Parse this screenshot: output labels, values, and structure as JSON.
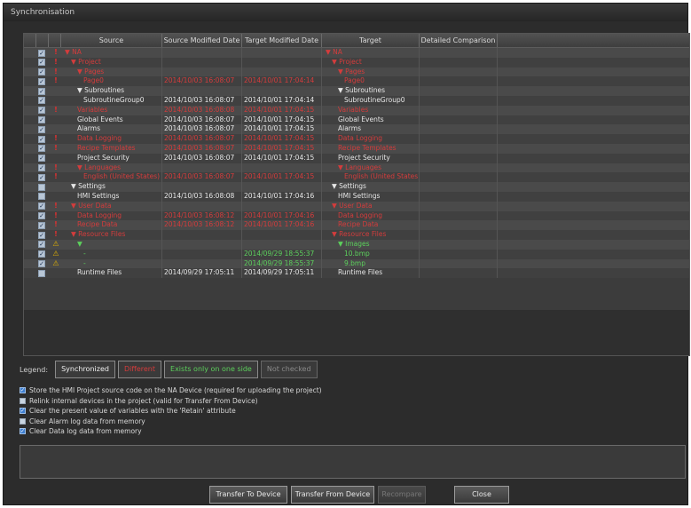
{
  "window": {
    "title": "Synchronisation"
  },
  "grid": {
    "headers": [
      "Source",
      "Source Modified Date",
      "Target Modified Date",
      "Target",
      "Detailed Comparison"
    ],
    "rows": [
      {
        "chk": true,
        "flag": "!",
        "src": "▼ NA",
        "sd": "",
        "td": "",
        "tgt": "▼ NA",
        "cls": "diff",
        "indent": 0
      },
      {
        "chk": true,
        "flag": "!",
        "src": "▼ Project",
        "sd": "",
        "td": "",
        "tgt": "▼ Project",
        "cls": "diff",
        "indent": 1
      },
      {
        "chk": true,
        "flag": "!",
        "src": "▼ Pages",
        "sd": "",
        "td": "",
        "tgt": "▼ Pages",
        "cls": "diff",
        "indent": 2
      },
      {
        "chk": true,
        "flag": "!",
        "src": "Page0",
        "sd": "2014/10/03 16:08:07",
        "td": "2014/10/01 17:04:14",
        "tgt": "Page0",
        "cls": "diff",
        "indent": 3
      },
      {
        "chk": true,
        "flag": "",
        "src": "▼ Subroutines",
        "sd": "",
        "td": "",
        "tgt": "▼ Subroutines",
        "cls": "",
        "indent": 2
      },
      {
        "chk": true,
        "flag": "",
        "src": "SubroutineGroup0",
        "sd": "2014/10/03 16:08:07",
        "td": "2014/10/01 17:04:14",
        "tgt": "SubroutineGroup0",
        "cls": "",
        "indent": 3
      },
      {
        "chk": true,
        "flag": "!",
        "src": "Variables",
        "sd": "2014/10/03 16:08:08",
        "td": "2014/10/01 17:04:15",
        "tgt": "Variables",
        "cls": "diff",
        "indent": 2
      },
      {
        "chk": true,
        "flag": "",
        "src": "Global Events",
        "sd": "2014/10/03 16:08:07",
        "td": "2014/10/01 17:04:15",
        "tgt": "Global Events",
        "cls": "",
        "indent": 2
      },
      {
        "chk": true,
        "flag": "",
        "src": "Alarms",
        "sd": "2014/10/03 16:08:07",
        "td": "2014/10/01 17:04:15",
        "tgt": "Alarms",
        "cls": "",
        "indent": 2
      },
      {
        "chk": true,
        "flag": "!",
        "src": "Data Logging",
        "sd": "2014/10/03 16:08:07",
        "td": "2014/10/01 17:04:15",
        "tgt": "Data Logging",
        "cls": "diff",
        "indent": 2
      },
      {
        "chk": true,
        "flag": "!",
        "src": "Recipe Templates",
        "sd": "2014/10/03 16:08:07",
        "td": "2014/10/01 17:04:15",
        "tgt": "Recipe Templates",
        "cls": "diff",
        "indent": 2
      },
      {
        "chk": true,
        "flag": "",
        "src": "Project Security",
        "sd": "2014/10/03 16:08:07",
        "td": "2014/10/01 17:04:15",
        "tgt": "Project Security",
        "cls": "",
        "indent": 2
      },
      {
        "chk": true,
        "flag": "!",
        "src": "▼ Languages",
        "sd": "",
        "td": "",
        "tgt": "▼ Languages",
        "cls": "diff",
        "indent": 2
      },
      {
        "chk": true,
        "flag": "!",
        "src": "English (United States)",
        "sd": "2014/10/03 16:08:07",
        "td": "2014/10/01 17:04:15",
        "tgt": "English (United States)",
        "cls": "diff",
        "indent": 3
      },
      {
        "chk": false,
        "flag": "",
        "src": "▼ Settings",
        "sd": "",
        "td": "",
        "tgt": "▼ Settings",
        "cls": "",
        "indent": 1
      },
      {
        "chk": false,
        "flag": "",
        "src": "HMI Settings",
        "sd": "2014/10/03 16:08:08",
        "td": "2014/10/01 17:04:16",
        "tgt": "HMI Settings",
        "cls": "",
        "indent": 2
      },
      {
        "chk": true,
        "flag": "!",
        "src": "▼ User Data",
        "sd": "",
        "td": "",
        "tgt": "▼ User Data",
        "cls": "diff",
        "indent": 1
      },
      {
        "chk": true,
        "flag": "!",
        "src": "Data Logging",
        "sd": "2014/10/03 16:08:12",
        "td": "2014/10/01 17:04:16",
        "tgt": "Data Logging",
        "cls": "diff",
        "indent": 2
      },
      {
        "chk": true,
        "flag": "!",
        "src": "Recipe Data",
        "sd": "2014/10/03 16:08:12",
        "td": "2014/10/01 17:04:16",
        "tgt": "Recipe Data",
        "cls": "diff",
        "indent": 2
      },
      {
        "chk": true,
        "flag": "!",
        "src": "▼ Resource Files",
        "sd": "",
        "td": "",
        "tgt": "▼ Resource Files",
        "cls": "diff",
        "indent": 1
      },
      {
        "chk": true,
        "flag": "⚠",
        "src": "▼",
        "sd": "",
        "td": "",
        "tgt": "▼ Images",
        "cls": "one",
        "indent": 2
      },
      {
        "chk": true,
        "flag": "⚠",
        "src": "-",
        "sd": "",
        "td": "2014/09/29 18:55:37",
        "tgt": "10.bmp",
        "cls": "one",
        "indent": 3
      },
      {
        "chk": true,
        "flag": "⚠",
        "src": "-",
        "sd": "",
        "td": "2014/09/29 18:55:37",
        "tgt": "9.bmp",
        "cls": "one",
        "indent": 3
      },
      {
        "chk": false,
        "flag": "",
        "src": "Runtime Files",
        "sd": "2014/09/29 17:05:11",
        "td": "2014/09/29 17:05:11",
        "tgt": "Runtime Files",
        "cls": "",
        "indent": 2
      }
    ]
  },
  "legend": {
    "label": "Legend:",
    "synchronized": "Synchronized",
    "different": "Different",
    "one_side": "Exists only on one side",
    "not_checked": "Not checked"
  },
  "options": [
    {
      "checked": true,
      "text": "Store the HMI Project source code on the NA Device (required for uploading the project)"
    },
    {
      "checked": false,
      "text": "Relink internal devices in the project (valid for Transfer From Device)"
    },
    {
      "checked": true,
      "text": "Clear the present value of variables with the 'Retain' attribute"
    },
    {
      "checked": false,
      "text": "Clear Alarm log data from memory"
    },
    {
      "checked": true,
      "text": "Clear Data log data from memory"
    }
  ],
  "buttons": {
    "transfer_to": "Transfer To Device",
    "transfer_from": "Transfer From Device",
    "recompare": "Recompare",
    "close": "Close"
  }
}
